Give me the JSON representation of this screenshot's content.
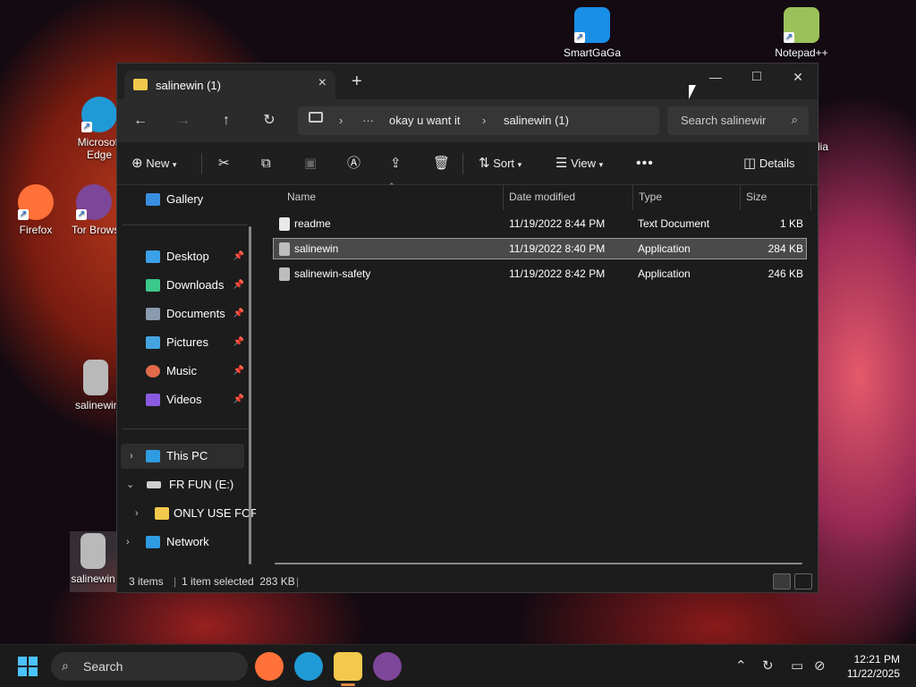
{
  "desktop": {
    "icons": [
      {
        "label": "SmartGaGa",
        "color": "#1a8fe8"
      },
      {
        "label": "Notepad++",
        "color": "#9bc25a"
      },
      {
        "label": "Microsoft Edge",
        "color": "#1f9ad6"
      },
      {
        "label": "Firefox",
        "color": "#ff7139"
      },
      {
        "label": "Tor Browser",
        "color": "#7d4698"
      },
      {
        "label": "salinewin",
        "color": "#b9b9b9"
      },
      {
        "label": "salinewin",
        "color": "#b9b9b9"
      },
      {
        "label": "lia",
        "color": "#1c1c1c"
      }
    ]
  },
  "window": {
    "tab_title": "salinewin (1)",
    "controls": {
      "minimize": "—",
      "maximize": "□",
      "close": "✕"
    },
    "breadcrumb": [
      "okay u want it",
      "salinewin (1)"
    ],
    "search_placeholder": "Search salinewir",
    "commands": {
      "new": "New",
      "sort": "Sort",
      "view": "View",
      "details": "Details"
    }
  },
  "navpane": {
    "gallery": "Gallery",
    "quick_access": [
      {
        "label": "Desktop",
        "color": "#3aa0e8"
      },
      {
        "label": "Downloads",
        "color": "#3cc88a"
      },
      {
        "label": "Documents",
        "color": "#8a9bb0"
      },
      {
        "label": "Pictures",
        "color": "#45a4e0"
      },
      {
        "label": "Music",
        "color": "#e06a4a"
      },
      {
        "label": "Videos",
        "color": "#8a5ae0"
      }
    ],
    "this_pc": "This PC",
    "drive": "FR FUN (E:)",
    "folder": "ONLY USE FOF",
    "network": "Network"
  },
  "columns": {
    "name": "Name",
    "date": "Date modified",
    "type": "Type",
    "size": "Size"
  },
  "files": [
    {
      "name": "readme",
      "date": "11/19/2022 8:44 PM",
      "type": "Text Document",
      "size": "1 KB"
    },
    {
      "name": "salinewin",
      "date": "11/19/2022 8:40 PM",
      "type": "Application",
      "size": "284 KB"
    },
    {
      "name": "salinewin-safety",
      "date": "11/19/2022 8:42 PM",
      "type": "Application",
      "size": "246 KB"
    }
  ],
  "status": {
    "items": "3 items",
    "selected": "1 item selected  283 KB"
  },
  "taskbar": {
    "search_placeholder": "Search",
    "time": "12:21 PM",
    "date": "11/22/2025"
  }
}
